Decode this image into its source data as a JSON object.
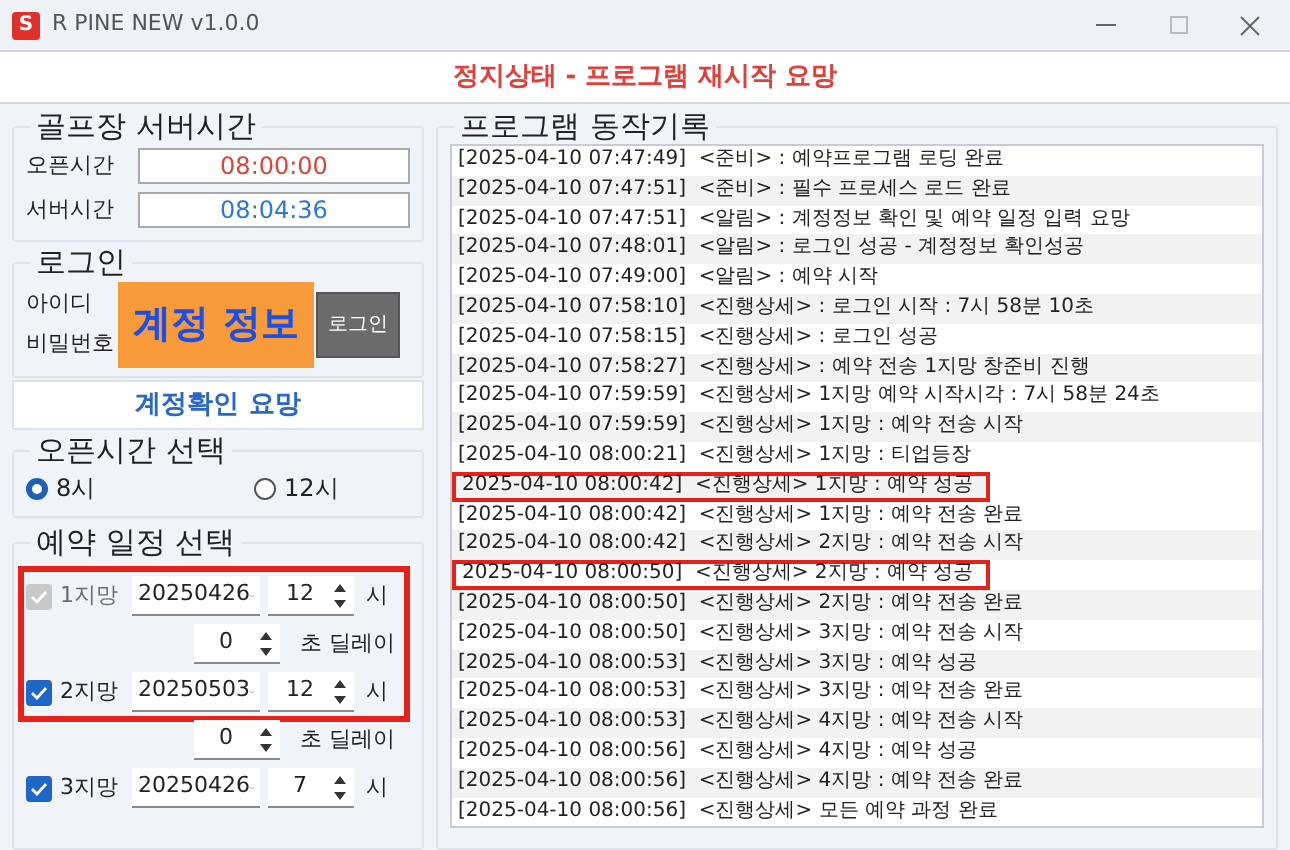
{
  "window": {
    "title": "R PINE NEW v1.0.0",
    "logo": "S"
  },
  "status": "정지상태 - 프로그램 재시작 요망",
  "server_time": {
    "title": "골프장 서버시간",
    "rows": [
      {
        "label": "오픈시간",
        "value": "08:00:00",
        "kind": "open"
      },
      {
        "label": "서버시간",
        "value": "08:04:36",
        "kind": "server"
      }
    ]
  },
  "login": {
    "title": "로그인",
    "id_label": "아이디",
    "password_label": "비밀번호",
    "mask": "계정 정보",
    "button": "로그인",
    "notice": "계정확인 요망"
  },
  "open_time": {
    "title": "오픈시간 선택",
    "options": [
      {
        "label": "8시",
        "selected": true
      },
      {
        "label": "12시",
        "selected": false
      }
    ]
  },
  "schedule": {
    "title": "예약 일정 선택",
    "rows": [
      {
        "kind": "choice",
        "label": "1지망",
        "checked": true,
        "disabled": true,
        "date": "20250426",
        "hour": "12",
        "unit": "시",
        "highlighted": true
      },
      {
        "kind": "delay",
        "value": "0",
        "unit": "초 딜레이",
        "highlighted": true
      },
      {
        "kind": "choice",
        "label": "2지망",
        "checked": true,
        "disabled": false,
        "date": "20250503",
        "hour": "12",
        "unit": "시",
        "highlighted": true
      },
      {
        "kind": "delay",
        "value": "0",
        "unit": "초 딜레이",
        "highlighted": false
      },
      {
        "kind": "choice",
        "label": "3지망",
        "checked": true,
        "disabled": false,
        "date": "20250426",
        "hour": "7",
        "unit": "시",
        "highlighted": false
      }
    ]
  },
  "log": {
    "title": "프로그램 동작기록",
    "rows": [
      {
        "text": "[2025-04-10 07:47:49]  <준비> : 예약프로그램 로딩 완료",
        "highlighted": false
      },
      {
        "text": "[2025-04-10 07:47:51]  <준비> : 필수 프로세스 로드 완료",
        "highlighted": false
      },
      {
        "text": "[2025-04-10 07:47:51]  <알림> : 계정정보 확인 및 예약 일정 입력 요망",
        "highlighted": false
      },
      {
        "text": "[2025-04-10 07:48:01]  <알림> : 로그인 성공 - 계정정보 확인성공",
        "highlighted": false
      },
      {
        "text": "[2025-04-10 07:49:00]  <알림> : 예약 시작",
        "highlighted": false
      },
      {
        "text": "[2025-04-10 07:58:10]  <진행상세> : 로그인 시작 : 7시 58분 10초",
        "highlighted": false
      },
      {
        "text": "[2025-04-10 07:58:15]  <진행상세> : 로그인 성공",
        "highlighted": false
      },
      {
        "text": "[2025-04-10 07:58:27]  <진행상세> : 예약 전송 1지망 창준비 진행",
        "highlighted": false
      },
      {
        "text": "[2025-04-10 07:59:59]  <진행상세> 1지망 예약 시작시각 : 7시 58분 24초",
        "highlighted": false
      },
      {
        "text": "[2025-04-10 07:59:59]  <진행상세> 1지망 : 예약 전송 시작",
        "highlighted": false
      },
      {
        "text": "[2025-04-10 08:00:21]  <진행상세> 1지망 : 티업등장",
        "highlighted": false
      },
      {
        "text": "2025-04-10 08:00:42]  <진행상세> 1지망 : 예약 성공",
        "highlighted": true
      },
      {
        "text": "[2025-04-10 08:00:42]  <진행상세> 1지망 : 예약 전송 완료",
        "highlighted": false
      },
      {
        "text": "[2025-04-10 08:00:42]  <진행상세> 2지망 : 예약 전송 시작",
        "highlighted": false
      },
      {
        "text": "2025-04-10 08:00:50]  <진행상세> 2지망 : 예약 성공",
        "highlighted": true
      },
      {
        "text": "[2025-04-10 08:00:50]  <진행상세> 2지망 : 예약 전송 완료",
        "highlighted": false
      },
      {
        "text": "[2025-04-10 08:00:50]  <진행상세> 3지망 : 예약 전송 시작",
        "highlighted": false
      },
      {
        "text": "[2025-04-10 08:00:53]  <진행상세> 3지망 : 예약 성공",
        "highlighted": false
      },
      {
        "text": "[2025-04-10 08:00:53]  <진행상세> 3지망 : 예약 전송 완료",
        "highlighted": false
      },
      {
        "text": "[2025-04-10 08:00:53]  <진행상세> 4지망 : 예약 전송 시작",
        "highlighted": false
      },
      {
        "text": "[2025-04-10 08:00:56]  <진행상세> 4지망 : 예약 성공",
        "highlighted": false
      },
      {
        "text": "[2025-04-10 08:00:56]  <진행상세> 4지망 : 예약 전송 완료",
        "highlighted": false
      },
      {
        "text": "[2025-04-10 08:00:56]  <진행상세> 모든 예약 과정 완료",
        "highlighted": false
      }
    ]
  }
}
